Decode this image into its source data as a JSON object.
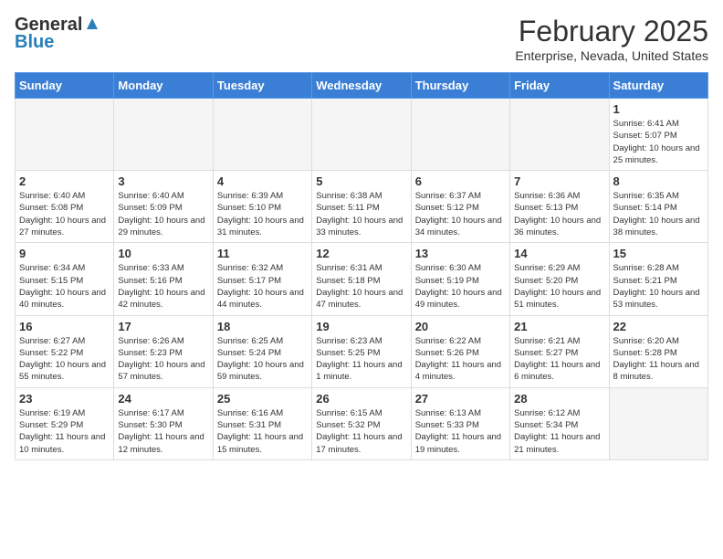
{
  "header": {
    "logo_general": "General",
    "logo_blue": "Blue",
    "month_year": "February 2025",
    "location": "Enterprise, Nevada, United States"
  },
  "weekdays": [
    "Sunday",
    "Monday",
    "Tuesday",
    "Wednesday",
    "Thursday",
    "Friday",
    "Saturday"
  ],
  "weeks": [
    [
      {
        "day": "",
        "info": ""
      },
      {
        "day": "",
        "info": ""
      },
      {
        "day": "",
        "info": ""
      },
      {
        "day": "",
        "info": ""
      },
      {
        "day": "",
        "info": ""
      },
      {
        "day": "",
        "info": ""
      },
      {
        "day": "1",
        "info": "Sunrise: 6:41 AM\nSunset: 5:07 PM\nDaylight: 10 hours and 25 minutes."
      }
    ],
    [
      {
        "day": "2",
        "info": "Sunrise: 6:40 AM\nSunset: 5:08 PM\nDaylight: 10 hours and 27 minutes."
      },
      {
        "day": "3",
        "info": "Sunrise: 6:40 AM\nSunset: 5:09 PM\nDaylight: 10 hours and 29 minutes."
      },
      {
        "day": "4",
        "info": "Sunrise: 6:39 AM\nSunset: 5:10 PM\nDaylight: 10 hours and 31 minutes."
      },
      {
        "day": "5",
        "info": "Sunrise: 6:38 AM\nSunset: 5:11 PM\nDaylight: 10 hours and 33 minutes."
      },
      {
        "day": "6",
        "info": "Sunrise: 6:37 AM\nSunset: 5:12 PM\nDaylight: 10 hours and 34 minutes."
      },
      {
        "day": "7",
        "info": "Sunrise: 6:36 AM\nSunset: 5:13 PM\nDaylight: 10 hours and 36 minutes."
      },
      {
        "day": "8",
        "info": "Sunrise: 6:35 AM\nSunset: 5:14 PM\nDaylight: 10 hours and 38 minutes."
      }
    ],
    [
      {
        "day": "9",
        "info": "Sunrise: 6:34 AM\nSunset: 5:15 PM\nDaylight: 10 hours and 40 minutes."
      },
      {
        "day": "10",
        "info": "Sunrise: 6:33 AM\nSunset: 5:16 PM\nDaylight: 10 hours and 42 minutes."
      },
      {
        "day": "11",
        "info": "Sunrise: 6:32 AM\nSunset: 5:17 PM\nDaylight: 10 hours and 44 minutes."
      },
      {
        "day": "12",
        "info": "Sunrise: 6:31 AM\nSunset: 5:18 PM\nDaylight: 10 hours and 47 minutes."
      },
      {
        "day": "13",
        "info": "Sunrise: 6:30 AM\nSunset: 5:19 PM\nDaylight: 10 hours and 49 minutes."
      },
      {
        "day": "14",
        "info": "Sunrise: 6:29 AM\nSunset: 5:20 PM\nDaylight: 10 hours and 51 minutes."
      },
      {
        "day": "15",
        "info": "Sunrise: 6:28 AM\nSunset: 5:21 PM\nDaylight: 10 hours and 53 minutes."
      }
    ],
    [
      {
        "day": "16",
        "info": "Sunrise: 6:27 AM\nSunset: 5:22 PM\nDaylight: 10 hours and 55 minutes."
      },
      {
        "day": "17",
        "info": "Sunrise: 6:26 AM\nSunset: 5:23 PM\nDaylight: 10 hours and 57 minutes."
      },
      {
        "day": "18",
        "info": "Sunrise: 6:25 AM\nSunset: 5:24 PM\nDaylight: 10 hours and 59 minutes."
      },
      {
        "day": "19",
        "info": "Sunrise: 6:23 AM\nSunset: 5:25 PM\nDaylight: 11 hours and 1 minute."
      },
      {
        "day": "20",
        "info": "Sunrise: 6:22 AM\nSunset: 5:26 PM\nDaylight: 11 hours and 4 minutes."
      },
      {
        "day": "21",
        "info": "Sunrise: 6:21 AM\nSunset: 5:27 PM\nDaylight: 11 hours and 6 minutes."
      },
      {
        "day": "22",
        "info": "Sunrise: 6:20 AM\nSunset: 5:28 PM\nDaylight: 11 hours and 8 minutes."
      }
    ],
    [
      {
        "day": "23",
        "info": "Sunrise: 6:19 AM\nSunset: 5:29 PM\nDaylight: 11 hours and 10 minutes."
      },
      {
        "day": "24",
        "info": "Sunrise: 6:17 AM\nSunset: 5:30 PM\nDaylight: 11 hours and 12 minutes."
      },
      {
        "day": "25",
        "info": "Sunrise: 6:16 AM\nSunset: 5:31 PM\nDaylight: 11 hours and 15 minutes."
      },
      {
        "day": "26",
        "info": "Sunrise: 6:15 AM\nSunset: 5:32 PM\nDaylight: 11 hours and 17 minutes."
      },
      {
        "day": "27",
        "info": "Sunrise: 6:13 AM\nSunset: 5:33 PM\nDaylight: 11 hours and 19 minutes."
      },
      {
        "day": "28",
        "info": "Sunrise: 6:12 AM\nSunset: 5:34 PM\nDaylight: 11 hours and 21 minutes."
      },
      {
        "day": "",
        "info": ""
      }
    ]
  ]
}
